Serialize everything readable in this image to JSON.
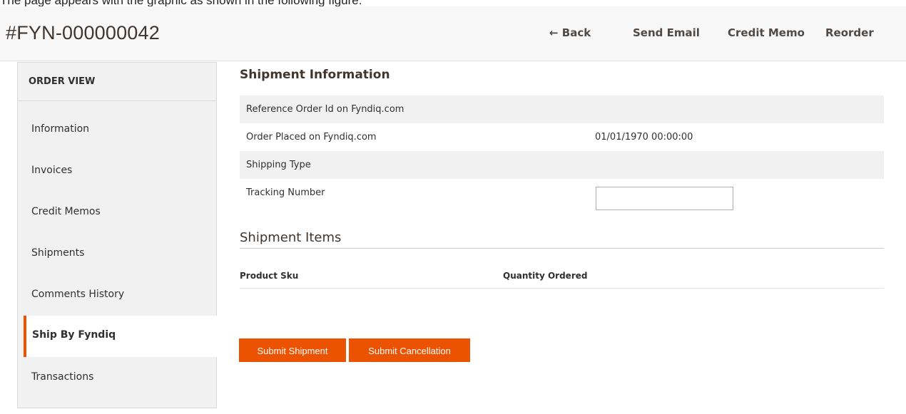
{
  "caption_text": "The page appears with the graphic as shown in the following figure:",
  "header": {
    "order_title": "#FYN-000000042",
    "actions": {
      "back": "← Back",
      "send_email": "Send Email",
      "credit_memo": "Credit Memo",
      "reorder": "Reorder"
    }
  },
  "sidebar": {
    "title": "ORDER VIEW",
    "items": [
      {
        "label": "Information"
      },
      {
        "label": "Invoices"
      },
      {
        "label": "Credit Memos"
      },
      {
        "label": "Shipments"
      },
      {
        "label": "Comments History"
      },
      {
        "label": "Ship By Fyndiq"
      },
      {
        "label": "Transactions"
      }
    ],
    "active": "Ship By Fyndiq"
  },
  "shipment_info": {
    "title": "Shipment Information",
    "rows": [
      {
        "label": "Reference Order Id on Fyndiq.com",
        "value": ""
      },
      {
        "label": "Order Placed on Fyndiq.com",
        "value": "01/01/1970 00:00:00"
      },
      {
        "label": "Shipping Type",
        "value": ""
      },
      {
        "label": "Tracking Number",
        "value": ""
      }
    ],
    "tracking_input_value": ""
  },
  "shipment_items": {
    "title": "Shipment Items",
    "columns": [
      "Product Sku",
      "Quantity Ordered"
    ],
    "rows": []
  },
  "buttons": {
    "submit_shipment": "Submit Shipment",
    "submit_cancellation": "Submit Cancellation"
  },
  "colors": {
    "accent": "#eb5202",
    "header_bg": "#f8f8f8",
    "sidebar_bg": "#f1f1f1"
  }
}
